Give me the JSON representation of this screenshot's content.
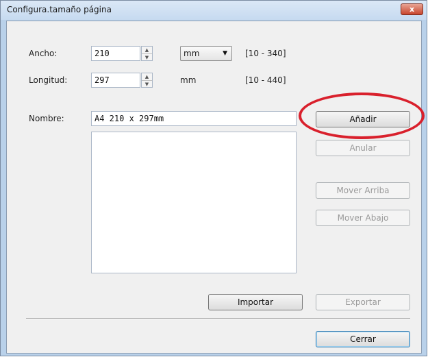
{
  "window": {
    "title": "Configura.tamaño página",
    "close_glyph": "x"
  },
  "ancho": {
    "label": "Ancho:",
    "value": "210",
    "unit": "mm",
    "range": "[10 - 340]"
  },
  "longitud": {
    "label": "Longitud:",
    "value": "297",
    "unit": "mm",
    "range": "[10 - 440]"
  },
  "nombre": {
    "label": "Nombre:",
    "value": "A4 210 x 297mm"
  },
  "buttons": {
    "anadir": "Añadir",
    "anular": "Anular",
    "mover_arriba": "Mover Arriba",
    "mover_abajo": "Mover Abajo",
    "importar": "Importar",
    "exportar": "Exportar",
    "cerrar": "Cerrar"
  },
  "icons": {
    "close": "close-icon",
    "spin_up": "spin-up-icon",
    "spin_down": "spin-down-icon",
    "dropdown": "chevron-down-icon"
  },
  "colors": {
    "highlight": "#d9202c",
    "title_bar": "#c6daf0",
    "close_button": "#c8452d"
  }
}
